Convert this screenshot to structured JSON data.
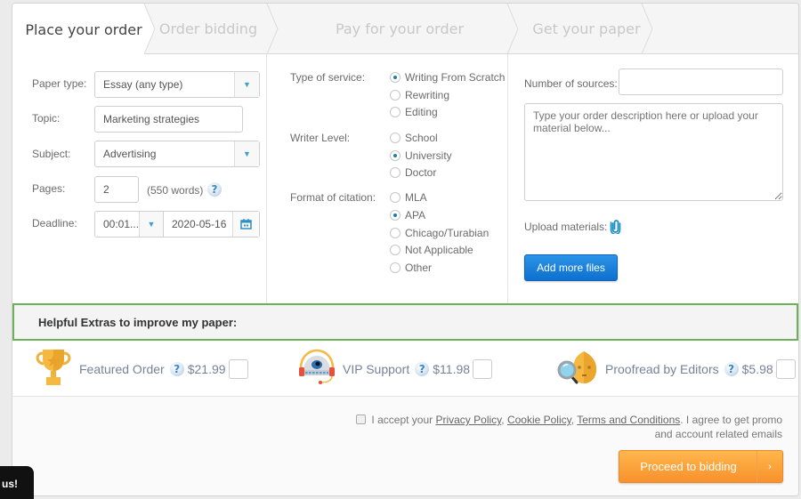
{
  "steps": [
    {
      "label": "Place your order",
      "active": true
    },
    {
      "label": "Order bidding",
      "active": false
    },
    {
      "label": "Pay for your order",
      "active": false
    },
    {
      "label": "Get your paper",
      "active": false
    }
  ],
  "form": {
    "paper_type": {
      "label": "Paper type:",
      "value": "Essay (any type)"
    },
    "topic": {
      "label": "Topic:",
      "value": "Marketing strategies"
    },
    "subject": {
      "label": "Subject:",
      "value": "Advertising"
    },
    "pages": {
      "label": "Pages:",
      "value": "2",
      "words": "(550 words)"
    },
    "deadline": {
      "label": "Deadline:",
      "time": "00:01...",
      "date": "2020-05-16"
    }
  },
  "options": {
    "service": {
      "label": "Type of service:",
      "items": [
        {
          "label": "Writing From Scratch",
          "checked": true
        },
        {
          "label": "Rewriting",
          "checked": false
        },
        {
          "label": "Editing",
          "checked": false
        }
      ]
    },
    "writer_level": {
      "label": "Writer Level:",
      "items": [
        {
          "label": "School",
          "checked": false
        },
        {
          "label": "University",
          "checked": true
        },
        {
          "label": "Doctor",
          "checked": false
        }
      ]
    },
    "citation": {
      "label": "Format of citation:",
      "items": [
        {
          "label": "MLA",
          "checked": false
        },
        {
          "label": "APA",
          "checked": true
        },
        {
          "label": "Chicago/Turabian",
          "checked": false
        },
        {
          "label": "Not Applicable",
          "checked": false
        },
        {
          "label": "Other",
          "checked": false
        }
      ]
    }
  },
  "materials": {
    "sources_label": "Number of sources:",
    "sources_value": "",
    "description_placeholder": "Type your order description here or upload your material below...",
    "upload_label": "Upload materials:",
    "add_files_label": "Add more files"
  },
  "extras": {
    "title": "Helpful Extras to improve my paper:",
    "items": [
      {
        "name": "Featured Order",
        "price": "$21.99",
        "icon": "trophy-icon",
        "checked": false
      },
      {
        "name": "VIP Support",
        "price": "$11.98",
        "icon": "headset-robot-icon",
        "checked": false
      },
      {
        "name": "Proofread by Editors",
        "price": "$5.98",
        "icon": "magnifier-robot-icon",
        "checked": false
      }
    ]
  },
  "footer": {
    "accept_prefix": "I accept your ",
    "privacy": "Privacy Policy",
    "comma1": ", ",
    "cookie": "Cookie Policy",
    "comma2": ", ",
    "terms": "Terms and Conditions",
    "accept_suffix": ". I agree to get promo and account related emails",
    "proceed_label": "Proceed to bidding",
    "proceed_arrow": "›"
  },
  "chat_tab": {
    "label": "us!"
  },
  "colors": {
    "accent_green": "#6cb05a",
    "button_blue": "#1a82dc",
    "button_orange": "#f8912c",
    "radio_dot": "#1d7fa8"
  }
}
